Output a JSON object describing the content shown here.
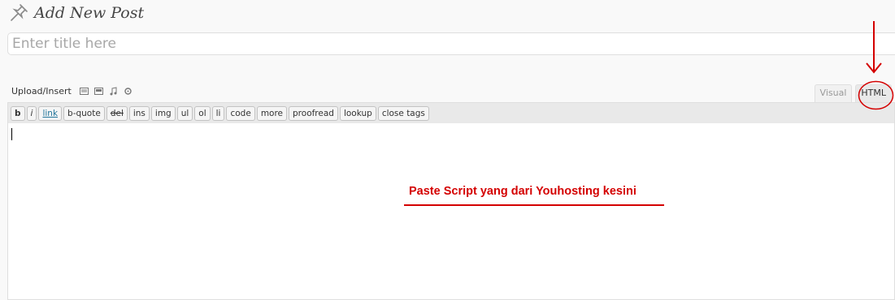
{
  "header": {
    "title": "Add New Post",
    "icon": "pushpin-icon"
  },
  "title_field": {
    "placeholder": "Enter title here",
    "value": ""
  },
  "upload": {
    "label": "Upload/Insert",
    "icons": [
      "image-icon",
      "video-icon",
      "audio-icon",
      "media-icon"
    ]
  },
  "tabs": {
    "visual": "Visual",
    "html": "HTML",
    "active": "HTML"
  },
  "quicktags": {
    "b": "b",
    "i": "i",
    "link": "link",
    "b_quote": "b-quote",
    "del": "del",
    "ins": "ins",
    "img": "img",
    "ul": "ul",
    "ol": "ol",
    "li": "li",
    "code": "code",
    "more": "more",
    "proofread": "proofread",
    "lookup": "lookup",
    "close_tags": "close tags"
  },
  "editor": {
    "content": ""
  },
  "annotation": {
    "text": "Paste Script yang dari Youhosting kesini",
    "color": "#d40000"
  }
}
